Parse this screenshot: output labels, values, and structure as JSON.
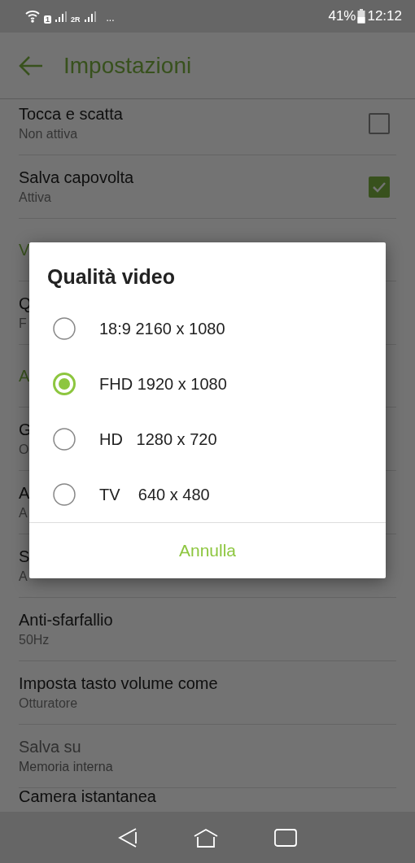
{
  "status_bar": {
    "sim1_label": "1",
    "sim2_label": "2R",
    "more": "...",
    "battery_text": "41%",
    "time": "12:12"
  },
  "app_bar": {
    "title": "Impostazioni"
  },
  "settings": [
    {
      "kind": "checkbox",
      "title": "Tocca e scatta",
      "subtitle": "Non attiva",
      "checked": false,
      "disabled": false
    },
    {
      "kind": "checkbox",
      "title": "Salva capovolta",
      "subtitle": "Attiva",
      "checked": true,
      "disabled": false
    },
    {
      "kind": "section",
      "title": "V"
    },
    {
      "kind": "text",
      "title": "Q",
      "subtitle": "F",
      "disabled": false
    },
    {
      "kind": "section",
      "title": "A"
    },
    {
      "kind": "text",
      "title": "G",
      "subtitle": "O",
      "disabled": false
    },
    {
      "kind": "text",
      "title": "A",
      "subtitle": "A",
      "disabled": false
    },
    {
      "kind": "text",
      "title": "S",
      "subtitle": "A",
      "disabled": false
    },
    {
      "kind": "text",
      "title": "Anti-sfarfallio",
      "subtitle": "50Hz",
      "disabled": false
    },
    {
      "kind": "text",
      "title": "Imposta tasto volume come",
      "subtitle": "Otturatore",
      "disabled": false
    },
    {
      "kind": "text",
      "title": "Salva su",
      "subtitle": "Memoria interna",
      "disabled": true
    },
    {
      "kind": "text",
      "title": "Camera istantanea"
    }
  ],
  "dialog": {
    "title": "Qualità video",
    "options": [
      {
        "label": "18:9 2160 x 1080",
        "selected": false
      },
      {
        "label": "FHD 1920 x 1080",
        "selected": true
      },
      {
        "label": "HD   1280 x 720",
        "selected": false
      },
      {
        "label": "TV    640 x 480",
        "selected": false
      }
    ],
    "cancel": "Annulla"
  }
}
